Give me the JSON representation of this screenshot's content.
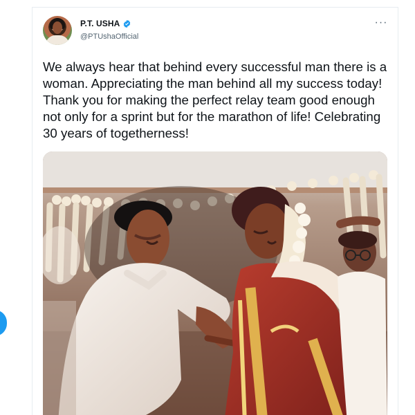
{
  "tweet": {
    "display_name": "P.T. USHA",
    "handle": "@PTUshaOfficial",
    "more_icon": "more-horizontal-icon",
    "text": "We always hear that behind every successful man there is a woman. Appreciating the man behind all my success today! Thank you for making the perfect relay team good enough not only for a sprint but for the marathon of life! Celebrating 30 years of togetherness!",
    "verified": true
  },
  "colors": {
    "text": "#0f1419",
    "secondary": "#536471",
    "accent": "#1d9bf0",
    "border": "#e6ecf0"
  },
  "media": {
    "icon_name": "photo-wedding-icon"
  }
}
